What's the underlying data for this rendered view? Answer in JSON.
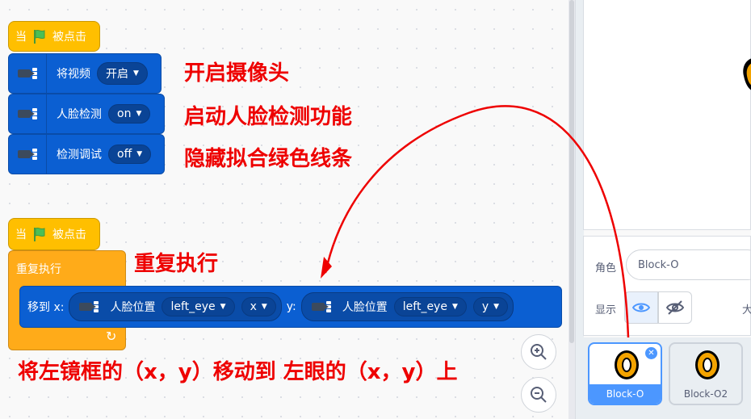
{
  "script1": {
    "hat_prefix": "当",
    "hat_suffix": "被点击",
    "video_label": "将视频",
    "video_value": "开启",
    "face_label": "人脸检测",
    "face_value": "on",
    "debug_label": "检测调试",
    "debug_value": "off"
  },
  "script2": {
    "hat_prefix": "当",
    "hat_suffix": "被点击",
    "repeat_label": "重复执行",
    "goto_label": "移到 x:",
    "y_label": "y:",
    "x_pos_label": "人脸位置",
    "x_part": "left_eye",
    "x_axis": "x",
    "y_pos_label": "人脸位置",
    "y_part": "left_eye",
    "y_axis": "y"
  },
  "annotations": {
    "a1": "开启摄像头",
    "a2": "启动人脸检测功能",
    "a3": "隐藏拟合绿色线条",
    "a4": "重复执行",
    "a5": "将左镜框的（x，y）移动到 左眼的（x，y）上"
  },
  "sprite_panel": {
    "sprite_label": "角色",
    "sprite_name": "Block-O",
    "show_label": "显示",
    "size_label": "大"
  },
  "sprites": [
    {
      "name": "Block-O",
      "selected": true
    },
    {
      "name": "Block-O2",
      "selected": false
    }
  ],
  "colors": {
    "accent": "#4c97ff",
    "annotation": "#ee0000",
    "event": "#ffbf00",
    "control": "#ffab19",
    "extension": "#0b5fd2"
  }
}
